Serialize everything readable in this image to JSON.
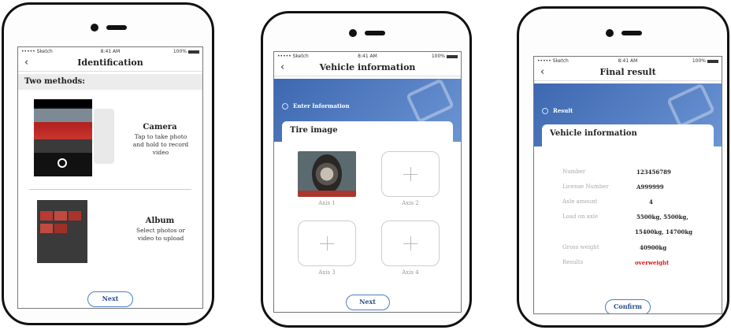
{
  "colors": {
    "accent": "#3d67b0",
    "danger": "#e01818",
    "button_border": "#4a7fc0"
  },
  "status_bar": {
    "carrier": "••••• Sketch",
    "time": "8:41 AM",
    "battery": "100%"
  },
  "screen1": {
    "back_icon": "‹",
    "title": "Identification",
    "section": "Two methods:",
    "camera": {
      "title": "Camera",
      "desc": "Tap to take photo and hold to record video"
    },
    "album": {
      "title": "Album",
      "desc": "Select photos or video to upload"
    },
    "next_label": "Next"
  },
  "screen2": {
    "back_icon": "‹",
    "title": "Vehicle information",
    "banner_label": "Enter Information",
    "card_title": "Tire image",
    "axes": [
      "Axis 1",
      "Axis 2",
      "Axis 3",
      "Axis 4"
    ],
    "plus_icon": "+",
    "next_label": "Next"
  },
  "screen3": {
    "back_icon": "‹",
    "title": "Final result",
    "banner_label": "Result",
    "card_title": "Vehicle information",
    "rows": [
      {
        "key": "Number",
        "value": "123456789"
      },
      {
        "key": "License Number",
        "value": "A999999"
      },
      {
        "key": "Axle amount",
        "value": "4"
      },
      {
        "key": "Load on axle",
        "value": "5500kg, 5500kg,"
      },
      {
        "key": "",
        "value": "15400kg, 14700kg"
      },
      {
        "key": "Gross weight",
        "value": "40900kg"
      },
      {
        "key": "Results",
        "value": "overweight"
      }
    ],
    "confirm_label": "Confirm"
  }
}
